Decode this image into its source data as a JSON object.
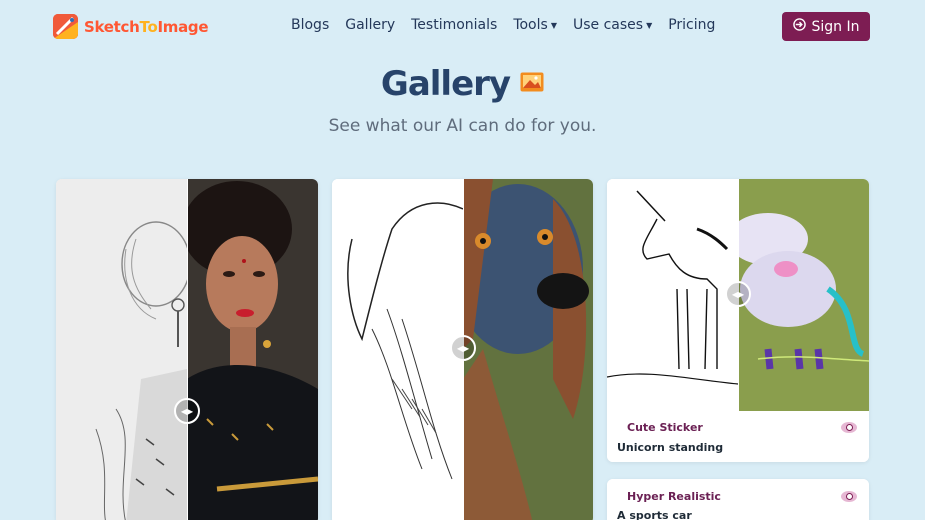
{
  "brand": {
    "name_part1": "Sketch",
    "name_part2": "To",
    "name_part3": "Image"
  },
  "nav": {
    "links": [
      "Blogs",
      "Gallery",
      "Testimonials"
    ],
    "tools_label": "Tools",
    "use_cases_label": "Use cases",
    "pricing_label": "Pricing",
    "signin_label": "Sign In"
  },
  "hero": {
    "title": "Gallery",
    "subtitle": "See what our AI can do for you."
  },
  "cards": [
    {
      "id": "portrait",
      "style": "",
      "caption": ""
    },
    {
      "id": "dog",
      "style": "",
      "caption": ""
    },
    {
      "id": "unicorn",
      "style": "Cute Sticker",
      "caption": "Unicorn standing"
    },
    {
      "id": "sports-car",
      "style": "Hyper Realistic",
      "caption": "A sports car"
    }
  ],
  "colors": {
    "background": "#d9edf6",
    "brand_accent": "#7d1d53",
    "logo_orange": "#ff5733",
    "title_navy": "#27436a"
  }
}
